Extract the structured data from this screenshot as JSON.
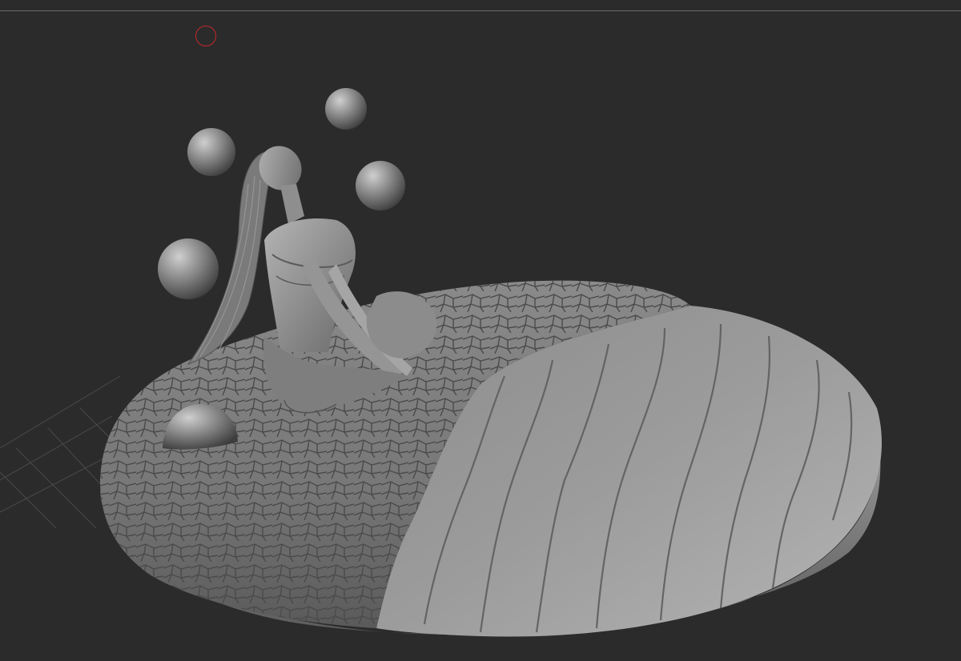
{
  "app": {
    "mode": "3d-sculpt-viewport"
  },
  "colors": {
    "canvas_background": "#2b2b2b",
    "top_rule": "#6a6a6a",
    "floor_grid": "#4a4a4a",
    "model_matcap_light": "#bdbdbd",
    "model_matcap_mid": "#8a8a8a",
    "model_matcap_dark": "#4a4a4a",
    "brush_cursor": "#c8282a"
  },
  "icons": {
    "brush_cursor": "circle-outline-icon"
  },
  "scene": {
    "objects": [
      "floor-grid",
      "base-disc",
      "cracked-stone-half",
      "flowing-water-half",
      "seated-figure",
      "floating-sphere",
      "floating-sphere",
      "floating-sphere",
      "floating-sphere",
      "ground-hemisphere"
    ]
  }
}
